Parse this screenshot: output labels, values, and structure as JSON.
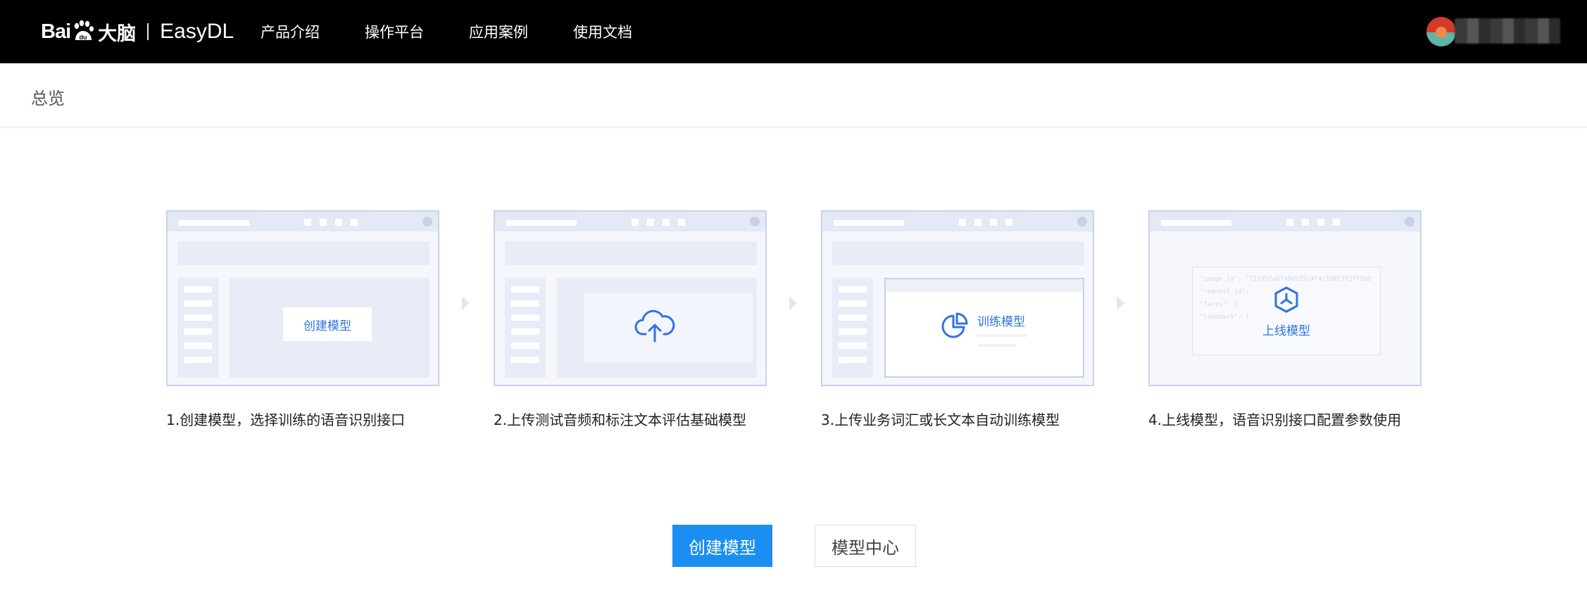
{
  "header": {
    "logo_bai": "Bai",
    "logo_du": "du",
    "logo_brain": "大脑",
    "logo_product": "EasyDL",
    "nav": [
      "产品介绍",
      "操作平台",
      "应用案例",
      "使用文档"
    ]
  },
  "breadcrumb": {
    "title": "总览"
  },
  "steps": [
    {
      "caption": "1.创建模型，选择训练的语音识别接口",
      "card_label": "创建模型"
    },
    {
      "caption": "2.上传测试音频和标注文本评估基础模型",
      "card_label": ""
    },
    {
      "caption": "3.上传业务词汇或长文本自动训练模型",
      "card_label": "训练模型"
    },
    {
      "caption": "4.上线模型，语音识别接口配置参数使用",
      "card_label": "上线模型"
    }
  ],
  "card4_code": [
    "\"image_id\": \"72fd5fa8f49d2f5c4f4cfd8f3f2ff9ab\",",
    "\"request_id\":",
    "\"faces\": [",
    "\"landmark\": {"
  ],
  "actions": {
    "primary": "创建模型",
    "secondary": "模型中心"
  },
  "colors": {
    "accent": "#1b8ef2",
    "icon_blue": "#2f74e0",
    "topbar": "#000000"
  }
}
